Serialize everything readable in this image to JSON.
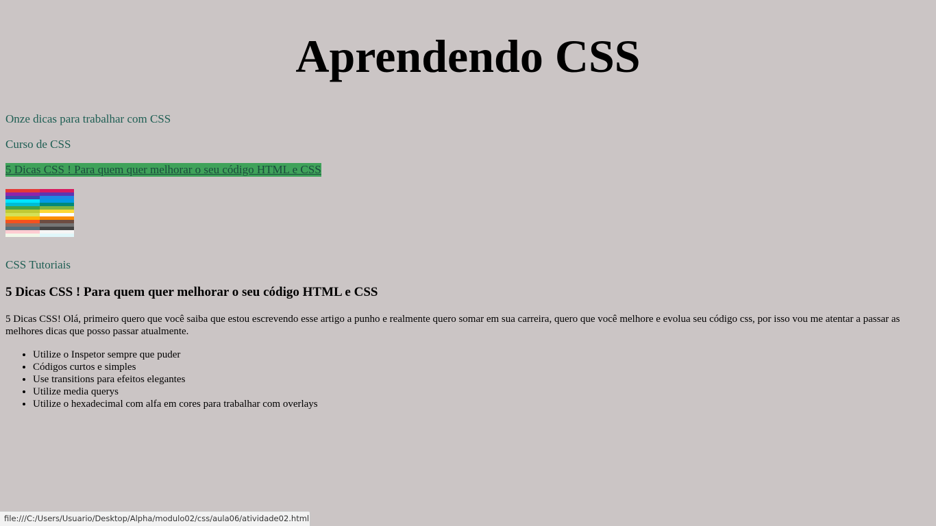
{
  "page": {
    "title": "Aprendendo CSS"
  },
  "links": [
    {
      "label": "Onze dicas para trabalhar com CSS"
    },
    {
      "label": "Curso de CSS"
    },
    {
      "label": "5 Dicas CSS ! Para quem quer melhorar o seu código HTML e CSS"
    },
    {
      "label": "CSS Tutoriais"
    }
  ],
  "palette_image": {
    "icon": "color-palette-image",
    "colors": [
      "#e53935",
      "#d81b60",
      "#8e24aa",
      "#5e35b1",
      "#3949ab",
      "#1e88e5",
      "#00e5ff",
      "#039be5",
      "#00bcd4",
      "#00897b",
      "#43a047",
      "#7cb342",
      "#c0ca33",
      "#fdd835",
      "#d4e157",
      "#ffffff",
      "#ffb300",
      "#fb8c00",
      "#f4511e",
      "#6d4c41",
      "#8d6e63",
      "#757575",
      "#546e7a",
      "#424242",
      "#ffcdd2",
      "#f5f5f5",
      "#f1f8e9",
      "#e0f7fa"
    ]
  },
  "article": {
    "heading": "5 Dicas CSS ! Para quem quer melhorar o seu código HTML e CSS",
    "body": "5 Dicas CSS! Olá, primeiro quero que você saiba que estou escrevendo esse artigo a punho e realmente quero somar em sua carreira, quero que você melhore e evolua seu código css, por isso vou me atentar a passar as melhores dicas que posso passar atualmente.",
    "tips": [
      "Utilize o Inspetor sempre que puder",
      "Códigos curtos e simples",
      "Use transitions para efeitos elegantes",
      "Utilize media querys",
      "Utilize o hexadecimal com alfa em cores para trabalhar com overlays"
    ]
  },
  "status_bar": {
    "url": "file:///C:/Users/Usuario/Desktop/Alpha/modulo02/css/aula06/atividade02.html#di..."
  }
}
